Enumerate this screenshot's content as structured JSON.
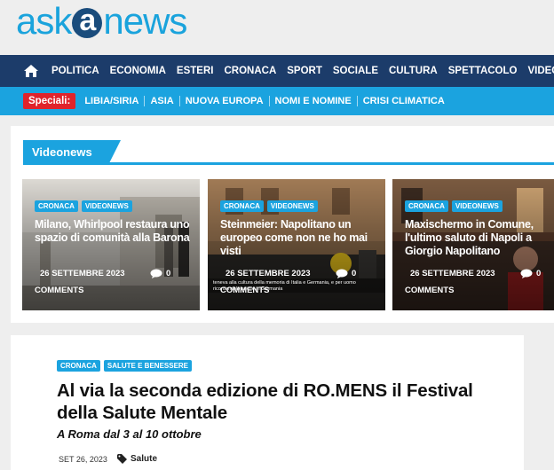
{
  "logo": {
    "part1": "ask",
    "part2": "a",
    "part3": "news"
  },
  "nav": {
    "items": [
      "POLITICA",
      "ECONOMIA",
      "ESTERI",
      "CRONACA",
      "SPORT",
      "SOCIALE",
      "CULTURA",
      "SPETTACOLO",
      "VIDEONEWS"
    ],
    "active": "ESTERI"
  },
  "specials": {
    "label": "Speciali:",
    "items": [
      "LIBIA/SIRIA",
      "ASIA",
      "NUOVA EUROPA",
      "NOMI E NOMINE",
      "CRISI CLIMATICA"
    ]
  },
  "videonews": {
    "title": "Videonews",
    "cards": [
      {
        "cat1": "CRONACA",
        "cat2": "VIDEONEWS",
        "title": "Milano, Whirlpool restaura uno spazio di comunità alla Barona",
        "date": "26 SETTEMBRE 2023",
        "comments": "0",
        "comments_label": "COMMENTS"
      },
      {
        "cat1": "CRONACA",
        "cat2": "VIDEONEWS",
        "title": "Steinmeier: Napolitano un europeo come non ne ho mai visti",
        "date": "26 SETTEMBRE 2023",
        "comments": "0",
        "comments_label": "COMMENTS",
        "caption": "teneva alla cultura della memoria di Italia e Germania, e per uomo ricordandolo anche in Germania"
      },
      {
        "cat1": "CRONACA",
        "cat2": "VIDEONEWS",
        "title": "Maxischermo in Comune, l'ultimo saluto di Napoli a Giorgio Napolitano",
        "date": "26 SETTEMBRE 2023",
        "comments": "0",
        "comments_label": "COMMENTS"
      }
    ]
  },
  "article": {
    "cat1": "CRONACA",
    "cat2": "SALUTE E BENESSERE",
    "title": "Al via la seconda edizione di RO.MENS il Festival della Salute Mentale",
    "subtitle": "A Roma dal 3 al 10 ottobre",
    "date": "SET 26, 2023",
    "tag": "Salute"
  },
  "colors": {
    "brand_blue": "#1ba3df",
    "nav_dark": "#1c3c6a",
    "special_red": "#e0232b"
  },
  "icons": {
    "home": "home-icon",
    "comment": "comment-bubble-icon",
    "tag": "tag-icon"
  }
}
